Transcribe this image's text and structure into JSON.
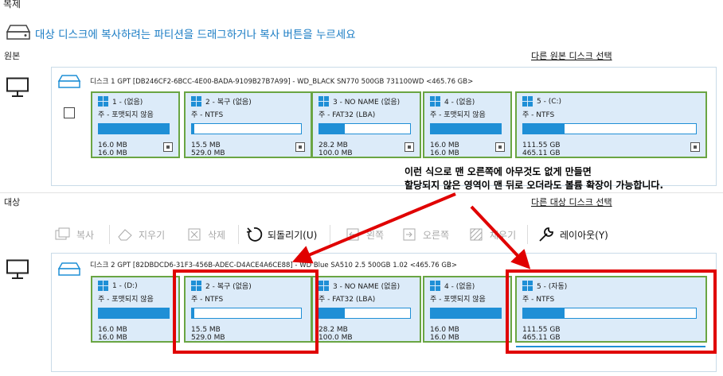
{
  "window_title": "복제",
  "instruction": "대상 디스크에 복사하려는 파티션을 드래그하거나 복사 버튼을 누르세요",
  "source": {
    "label": "원본",
    "change_link": "다른 원본 디스크 선택",
    "disk_title": "디스크 1 GPT [DB246CF2-6BCC-4E00-BADA-9109B27B7A99] - WD_BLACK SN770 500GB 731100WD  <465.76 GB>",
    "partitions": [
      {
        "name": "1 - (없음)",
        "type": "주 - 포맷되지 않음",
        "used": "16.0 MB",
        "total": "16.0 MB",
        "fill": 1.0
      },
      {
        "name": "2 - 복구 (없음)",
        "type": "주 - NTFS",
        "used": "15.5 MB",
        "total": "529.0 MB",
        "fill": 0.02
      },
      {
        "name": "3 - NO NAME (없음)",
        "type": "주 - FAT32 (LBA)",
        "used": "28.2 MB",
        "total": "100.0 MB",
        "fill": 0.28
      },
      {
        "name": "4 - (없음)",
        "type": "주 - 포맷되지 않음",
        "used": "16.0 MB",
        "total": "16.0 MB",
        "fill": 1.0
      },
      {
        "name": "5 - (C:)",
        "type": "주 - NTFS",
        "used": "111.55 GB",
        "total": "465.11 GB",
        "fill": 0.24
      }
    ]
  },
  "target": {
    "label": "대상",
    "change_link": "다른 대상 디스크 선택",
    "disk_title": "디스크 2 GPT [82DBDCD6-31F3-456B-ADEC-D4ACE4A6CE88] - WD Blue  SA510 2.5 500GB  1.02  <465.76 GB>",
    "partitions": [
      {
        "name": "1 - (D:)",
        "type": "주 - 포맷되지 않음",
        "used": "16.0 MB",
        "total": "16.0 MB",
        "fill": 1.0
      },
      {
        "name": "2 - 복구 (없음)",
        "type": "주 - NTFS",
        "used": "15.5 MB",
        "total": "529.0 MB",
        "fill": 0.02
      },
      {
        "name": "3 - NO NAME (없음)",
        "type": "주 - FAT32 (LBA)",
        "used": "28.2 MB",
        "total": "100.0 MB",
        "fill": 0.28
      },
      {
        "name": "4 - (없음)",
        "type": "주 - 포맷되지 않음",
        "used": "16.0 MB",
        "total": "16.0 MB",
        "fill": 1.0
      },
      {
        "name": "5 - (자동)",
        "type": "주 - NTFS",
        "used": "111.55 GB",
        "total": "465.11 GB",
        "fill": 0.24
      }
    ]
  },
  "toolbar": {
    "copy": "복사",
    "erase": "지우기",
    "delete": "삭제",
    "undo": "되돌리기(U)",
    "left": "왼쪽",
    "right": "오른쪽",
    "fill": "채우기",
    "layout": "레이아웃(Y)"
  },
  "annotation": {
    "line1": "이런 식으로 맨 오른쪽에 아무것도 없게 만들면",
    "line2": "할당되지 않은 영역이 맨 뒤로 오더라도 볼륨 확장이 가능합니다."
  },
  "colors": {
    "accent": "#1f8fd6",
    "partition_bg": "#dcebf9",
    "partition_border": "#6aa543",
    "annotation_red": "#e00000",
    "instruction_text": "#1a7cc4"
  }
}
